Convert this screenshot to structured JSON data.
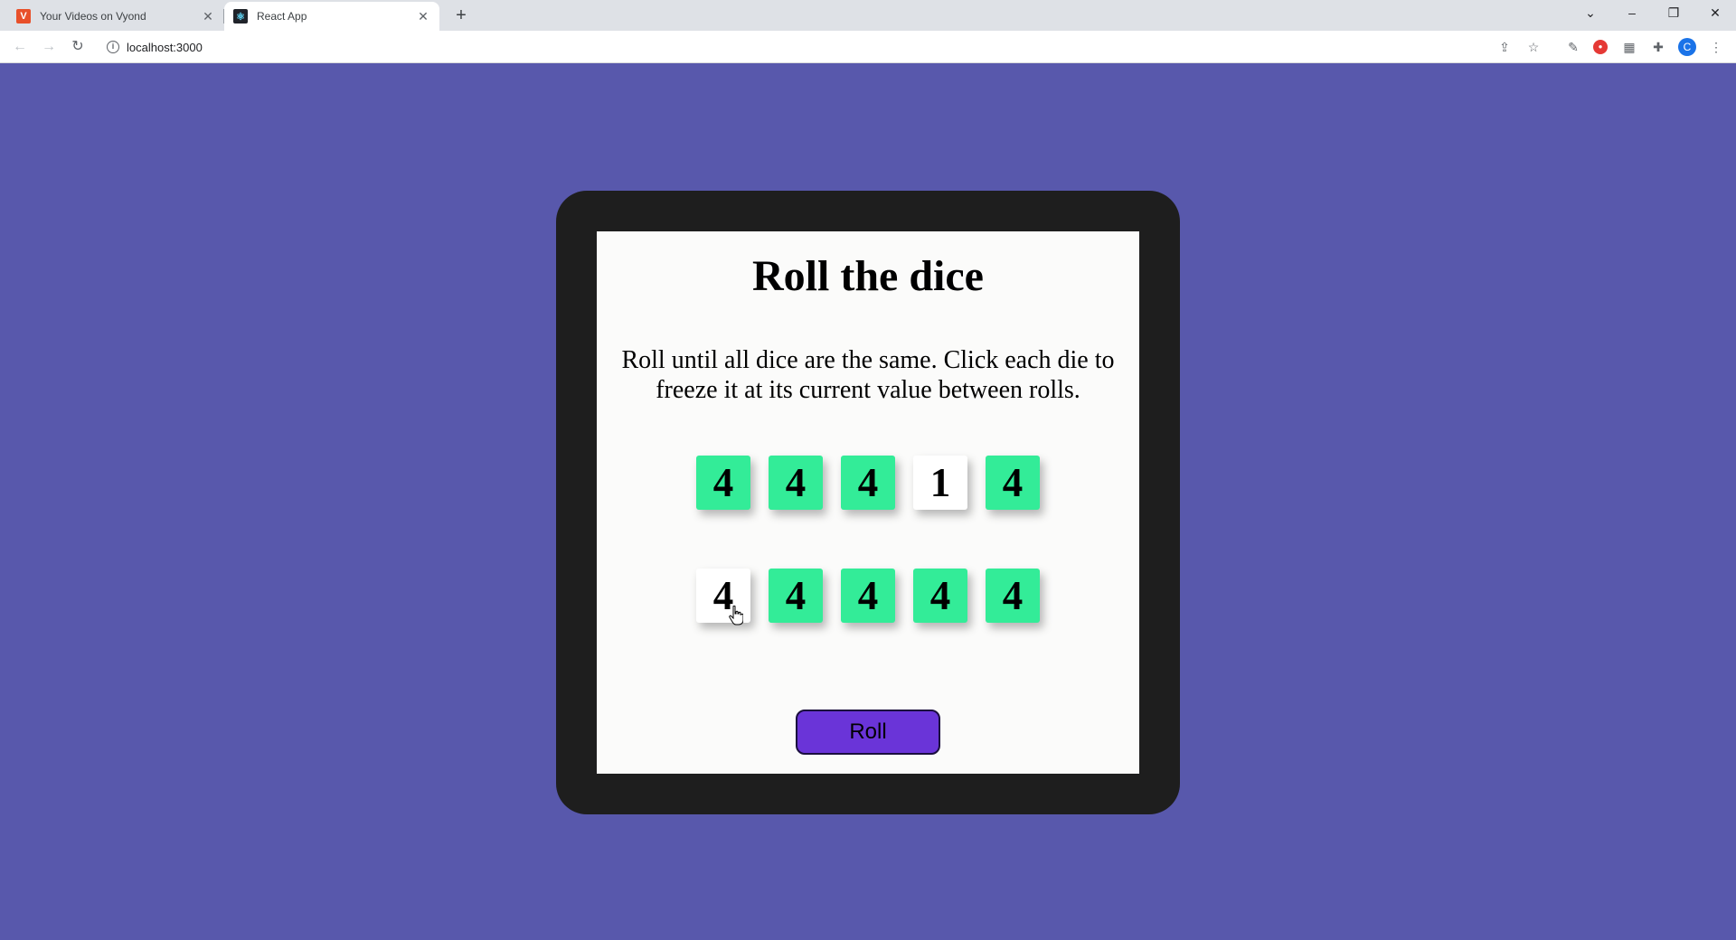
{
  "browser": {
    "tabs": [
      {
        "title": "Your Videos on Vyond",
        "favicon": "V"
      },
      {
        "title": "React App",
        "favicon": "⚛"
      }
    ],
    "url": "localhost:3000",
    "profile_initial": "C"
  },
  "app": {
    "title": "Roll the dice",
    "instructions": "Roll until all dice are the same. Click each die to freeze it at its current value between rolls.",
    "dice": [
      {
        "value": 4,
        "held": true
      },
      {
        "value": 4,
        "held": true
      },
      {
        "value": 4,
        "held": true
      },
      {
        "value": 1,
        "held": false
      },
      {
        "value": 4,
        "held": true
      },
      {
        "value": 4,
        "held": false
      },
      {
        "value": 4,
        "held": true
      },
      {
        "value": 4,
        "held": true
      },
      {
        "value": 4,
        "held": true
      },
      {
        "value": 4,
        "held": true
      }
    ],
    "roll_label": "Roll"
  },
  "colors": {
    "page_background": "#5858ac",
    "frame": "#1e1e1e",
    "held_die": "#33ec98",
    "roll_button": "#6a34d8"
  }
}
